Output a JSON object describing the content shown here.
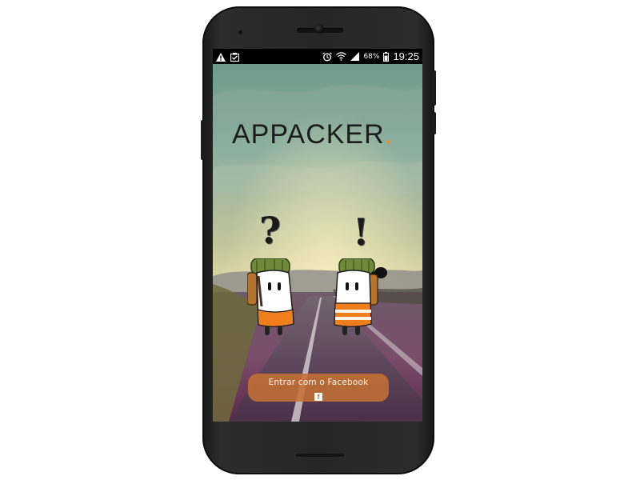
{
  "status_bar": {
    "left_icons": [
      "warning-icon",
      "clipboard-check-icon"
    ],
    "right_icons": [
      "alarm-icon",
      "wifi-icon",
      "signal-icon",
      "battery-icon"
    ],
    "battery_percent": "68%",
    "time": "19:25"
  },
  "app": {
    "logo": "APPACKER",
    "logo_dot": ".",
    "left_character_mark": "?",
    "right_character_mark": "!"
  },
  "login": {
    "facebook_label": "Entrar com o Facebook",
    "facebook_icon_glyph": "f"
  },
  "colors": {
    "accent": "#f28a1f",
    "button": "#c47034",
    "phone_body": "#262626"
  }
}
